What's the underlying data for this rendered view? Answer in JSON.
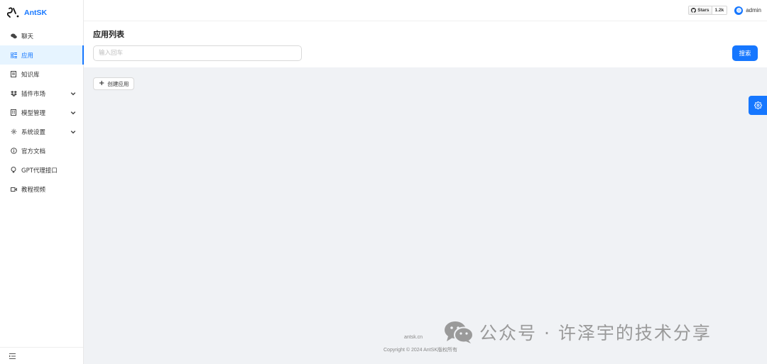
{
  "brand": {
    "logo": "ʕ ,",
    "name": "AntSK"
  },
  "sidebar": {
    "items": [
      {
        "label": "聊天",
        "icon": "chat-icon"
      },
      {
        "label": "应用",
        "icon": "apps-icon",
        "active": true
      },
      {
        "label": "知识库",
        "icon": "book-icon"
      },
      {
        "label": "插件市场",
        "icon": "dropbox-icon",
        "expandable": true
      },
      {
        "label": "模型管理",
        "icon": "building-icon",
        "expandable": true
      },
      {
        "label": "系统设置",
        "icon": "gear-icon",
        "expandable": true
      },
      {
        "label": "官方文档",
        "icon": "info-icon"
      },
      {
        "label": "GPT代理接口",
        "icon": "bulb-icon"
      },
      {
        "label": "教程视频",
        "icon": "video-icon"
      }
    ]
  },
  "header": {
    "github": {
      "label": "Stars",
      "count": "1.2k"
    },
    "user": {
      "name": "admin"
    }
  },
  "page": {
    "title": "应用列表",
    "search": {
      "placeholder": "输入回车",
      "value": ""
    },
    "search_button": "搜索",
    "create_button": "创建应用"
  },
  "footer": {
    "link": "antsk.cn",
    "copyright": "Copyright © 2024 AntSK版权所有"
  },
  "watermark": {
    "text": "公众号 · 许泽宇的技术分享"
  },
  "colors": {
    "primary": "#1677ff",
    "background": "#f0f2f5",
    "sidebar_active_bg": "#e6f4ff"
  }
}
